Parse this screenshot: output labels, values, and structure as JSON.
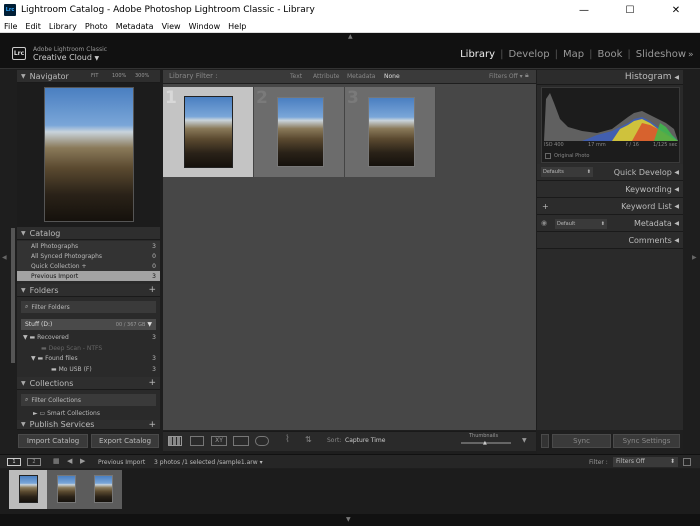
{
  "window": {
    "title": "Lightroom Catalog - Adobe Photoshop Lightroom Classic - Library",
    "app_icon": "Lrc",
    "minimize": "—",
    "maximize": "☐",
    "close": "✕"
  },
  "menu": [
    "File",
    "Edit",
    "Library",
    "Photo",
    "Metadata",
    "View",
    "Window",
    "Help"
  ],
  "identity": {
    "line1": "Adobe Lightroom Classic",
    "line2": "Creative Cloud",
    "logo": "Lrc"
  },
  "modules": [
    {
      "label": "Library",
      "active": true
    },
    {
      "label": "Develop"
    },
    {
      "label": "Map"
    },
    {
      "label": "Book"
    },
    {
      "label": "Slideshow"
    }
  ],
  "modules_more": "»",
  "navigator": {
    "title": "Navigator",
    "zoom": [
      "FIT",
      "100%",
      "300%"
    ]
  },
  "catalog": {
    "title": "Catalog",
    "items": [
      {
        "label": "All Photographs",
        "count": "3"
      },
      {
        "label": "All Synced Photographs",
        "count": "0"
      },
      {
        "label": "Quick Collection +",
        "count": "0"
      },
      {
        "label": "Previous Import",
        "count": "3"
      }
    ]
  },
  "folders": {
    "title": "Folders",
    "add": "+",
    "filter": "Filter Folders",
    "volume": "Stuff (D:)",
    "volume_info": "00 / 367 GB",
    "items": [
      {
        "label": "Recovered",
        "count": "3"
      },
      {
        "label": "Deep Scan - NTFS",
        "count": ""
      },
      {
        "label": "Found files",
        "count": "3"
      },
      {
        "label": "Mo USB (F)",
        "count": "3"
      }
    ]
  },
  "collections": {
    "title": "Collections",
    "add": "+",
    "filter": "Filter Collections",
    "items": [
      {
        "label": "Smart Collections"
      }
    ]
  },
  "publish": {
    "title": "Publish Services",
    "add": "+"
  },
  "left_buttons": {
    "import": "Import Catalog",
    "export": "Export Catalog"
  },
  "filter_bar": {
    "title": "Library Filter :",
    "options": [
      "Text",
      "Attribute",
      "Metadata",
      "None"
    ],
    "filters_off": "Filters Off"
  },
  "grid": {
    "cells": [
      {
        "index": "1",
        "selected": true
      },
      {
        "index": "2"
      },
      {
        "index": "3"
      }
    ]
  },
  "toolbar": {
    "sort_label": "Sort:",
    "sort_value": "Capture Time",
    "thumbnails": "Thumbnails"
  },
  "histogram": {
    "title": "Histogram",
    "meta": [
      "ISO 400",
      "17 mm",
      "f / 16",
      "1/125 sec"
    ],
    "original_photo": "Original Photo"
  },
  "right_panels": {
    "quick_develop": "Quick Develop",
    "defaults": "Defaults",
    "keywording": "Keywording",
    "keyword_list": "Keyword List",
    "metadata": "Metadata",
    "metadata_default": "Default",
    "comments": "Comments"
  },
  "right_buttons": {
    "sync": "Sync",
    "sync_settings": "Sync Settings"
  },
  "filmstrip": {
    "pages": [
      "1",
      "2"
    ],
    "source": "Previous Import",
    "info": "3 photos /1 selected /sample1.arw ▾",
    "filter_label": "Filter :",
    "filter_value": "Filters Off"
  }
}
